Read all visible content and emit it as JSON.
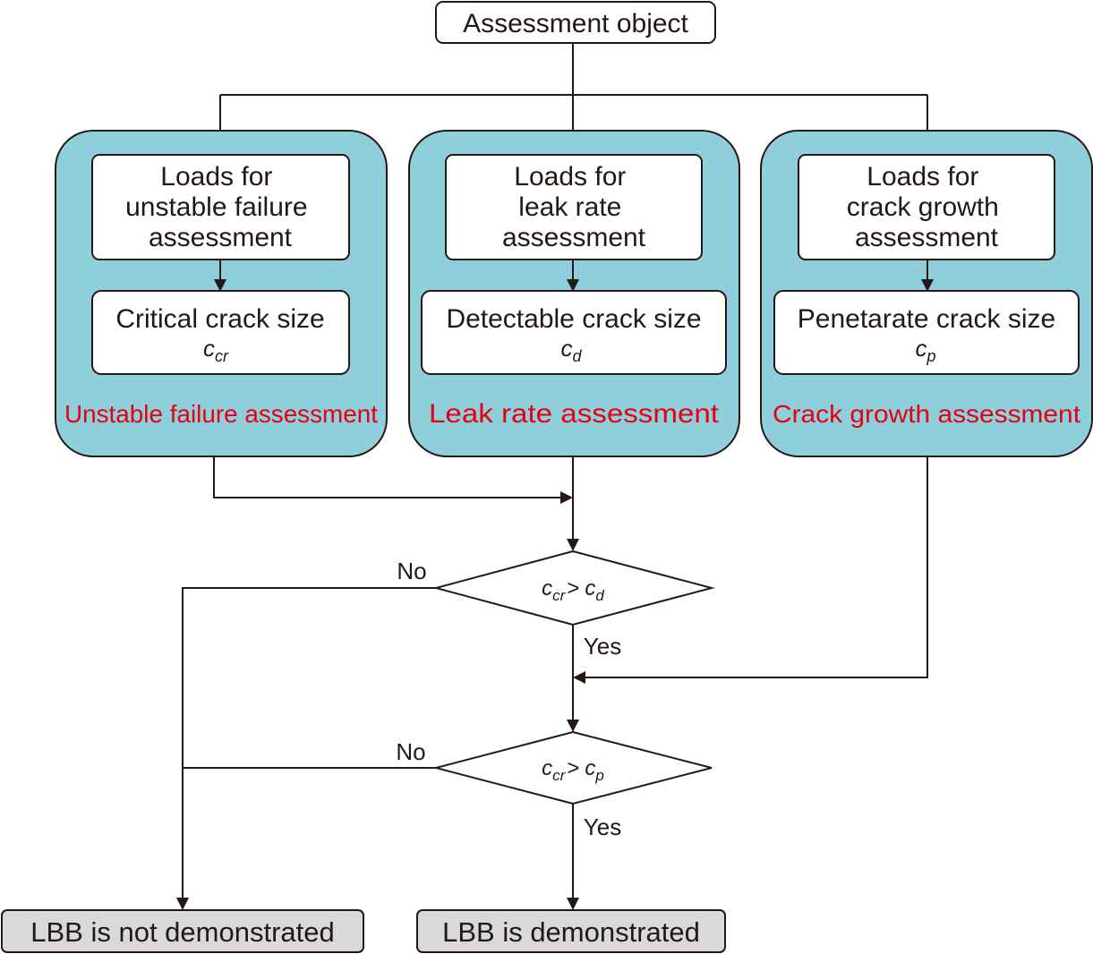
{
  "start": {
    "label": "Assessment object"
  },
  "groups": [
    {
      "title": "Unstable failure assessment",
      "loads": [
        "Loads for",
        "unstable failure",
        "assessment"
      ],
      "size_label": "Critical crack size",
      "symbol": "c",
      "sub": "cr"
    },
    {
      "title": "Leak rate assessment",
      "loads": [
        "Loads for",
        "leak rate",
        "assessment"
      ],
      "size_label": "Detectable crack size",
      "symbol": "c",
      "sub": "d"
    },
    {
      "title": "Crack growth assessment",
      "loads": [
        "Loads for",
        "crack growth",
        "assessment"
      ],
      "size_label": "Penetarate crack size",
      "symbol": "c",
      "sub": "p"
    }
  ],
  "decisions": [
    {
      "lhs": "c",
      "lhs_sub": "cr",
      "op": ">",
      "rhs": "c",
      "rhs_sub": "d",
      "no": "No",
      "yes": "Yes"
    },
    {
      "lhs": "c",
      "lhs_sub": "cr",
      "op": ">",
      "rhs": "c",
      "rhs_sub": "p",
      "no": "No",
      "yes": "Yes"
    }
  ],
  "outcomes": {
    "fail": "LBB is not demonstrated",
    "pass": "LBB is demonstrated"
  },
  "colors": {
    "group_fill": "#8ecfdb",
    "title_red": "#e60012",
    "end_fill": "#d9d9d9"
  }
}
